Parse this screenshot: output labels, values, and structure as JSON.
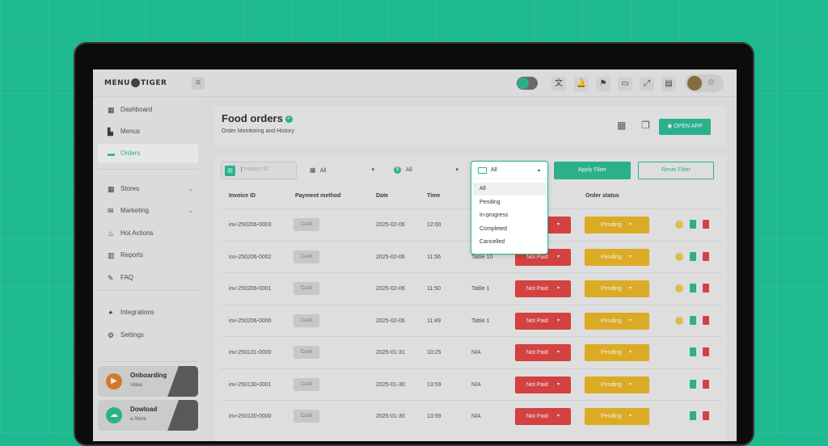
{
  "topbar": {
    "logo": "MENU TIGER",
    "icons": [
      "translate-icon",
      "bell-icon",
      "flag-icon",
      "devices-icon",
      "expand-icon",
      "receipt-icon"
    ]
  },
  "sidebar": {
    "items": [
      {
        "label": "Dashboard",
        "icon": "dashboard-icon"
      },
      {
        "label": "Menus",
        "icon": "menu-icon"
      },
      {
        "label": "Orders",
        "icon": "orders-icon",
        "active": true
      },
      {
        "label": "Stores",
        "icon": "store-icon",
        "expandable": true
      },
      {
        "label": "Marketing",
        "icon": "megaphone-icon",
        "expandable": true
      },
      {
        "label": "Hot Actions",
        "icon": "fire-icon"
      },
      {
        "label": "Reports",
        "icon": "report-icon"
      },
      {
        "label": "FAQ",
        "icon": "chat-icon"
      },
      {
        "label": "Integrations",
        "icon": "puzzle-icon"
      },
      {
        "label": "Settings",
        "icon": "gear-icon"
      }
    ],
    "cards": [
      {
        "title": "Onboarding",
        "subtitle": "Video",
        "color": "#e07a1f"
      },
      {
        "title": "Dowload",
        "subtitle": "e-Store",
        "color": "#1fb98f"
      }
    ]
  },
  "header": {
    "title": "Food orders",
    "subtitle": "Order Monitoring and History",
    "open_app": "OPEN APP"
  },
  "filters": {
    "invoice_placeholder": "Invoice ID",
    "select1_value": "All",
    "select2_value": "All",
    "select3_value": "All",
    "apply": "Apply Filter",
    "reset": "Reset Filter"
  },
  "dropdown": {
    "value": "All",
    "options": [
      "All",
      "Pending",
      "In-progress",
      "Completed",
      "Cancelled"
    ]
  },
  "table": {
    "headers": [
      "Invoice ID",
      "Payment method",
      "Date",
      "Time",
      "Order status"
    ],
    "rows": [
      {
        "invoice": "inv-250206-0003",
        "method": "Cash",
        "date": "2025-02-06",
        "time": "12:00",
        "table": "",
        "payment": "Not Paid",
        "status": "Pending",
        "fav": true
      },
      {
        "invoice": "inv-250206-0002",
        "method": "Cash",
        "date": "2025-02-06",
        "time": "11:56",
        "table": "Table 10",
        "payment": "Not Paid",
        "status": "Pending",
        "fav": true
      },
      {
        "invoice": "inv-250206-0001",
        "method": "Cash",
        "date": "2025-02-06",
        "time": "11:50",
        "table": "Table 1",
        "payment": "Not Paid",
        "status": "Pending",
        "fav": true
      },
      {
        "invoice": "inv-250206-0000",
        "method": "Cash",
        "date": "2025-02-06",
        "time": "11:49",
        "table": "Table 1",
        "payment": "Not Paid",
        "status": "Pending",
        "fav": true
      },
      {
        "invoice": "inv-250131-0000",
        "method": "Cash",
        "date": "2025-01-31",
        "time": "10:25",
        "table": "N/A",
        "payment": "Not Paid",
        "status": "Pending",
        "fav": false
      },
      {
        "invoice": "inv-250130-0001",
        "method": "Cash",
        "date": "2025-01-30",
        "time": "13:59",
        "table": "N/A",
        "payment": "Not Paid",
        "status": "Pending",
        "fav": false
      },
      {
        "invoice": "inv-250130-0000",
        "method": "Cash",
        "date": "2025-01-30",
        "time": "13:59",
        "table": "N/A",
        "payment": "Not Paid",
        "status": "Pending",
        "fav": false
      }
    ]
  }
}
